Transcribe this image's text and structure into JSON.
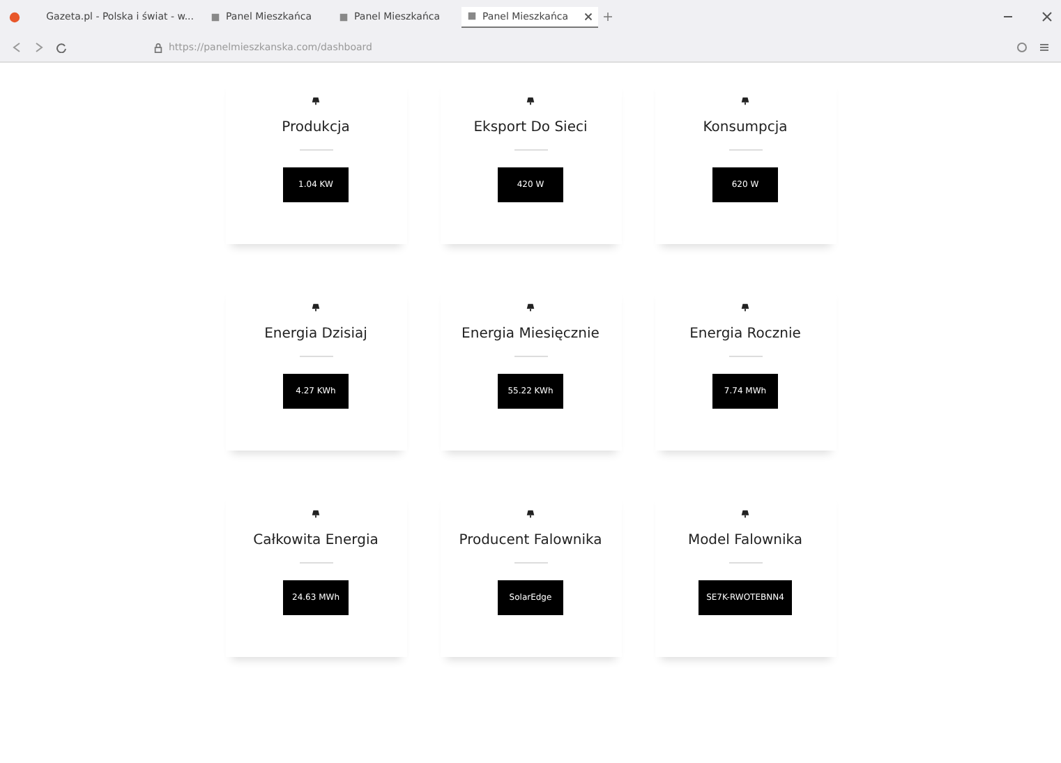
{
  "browser": {
    "tabs": [
      {
        "title": "Gazeta.pl - Polska i świat - w...",
        "selected": false
      },
      {
        "title": "Panel Mieszkańca",
        "selected": false
      },
      {
        "title": "Panel Mieszkańca",
        "selected": false
      },
      {
        "title": "Panel Mieszkańca",
        "selected": true
      }
    ],
    "url": "https://panelmieszkanska.com/dashboard"
  },
  "cards": [
    {
      "title": "Produkcja",
      "value": "1.04 KW"
    },
    {
      "title": "Eksport Do Sieci",
      "value": "420 W"
    },
    {
      "title": "Konsumpcja",
      "value": "620 W"
    },
    {
      "title": "Energia Dzisiaj",
      "value": "4.27 KWh"
    },
    {
      "title": "Energia Miesięcznie",
      "value": "55.22 KWh"
    },
    {
      "title": "Energia Rocznie",
      "value": "7.74 MWh"
    },
    {
      "title": "Całkowita Energia",
      "value": "24.63 MWh"
    },
    {
      "title": "Producent Falownika",
      "value": "SolarEdge"
    },
    {
      "title": "Model Falownika",
      "value": "SE7K-RWOTEBNN4"
    }
  ]
}
